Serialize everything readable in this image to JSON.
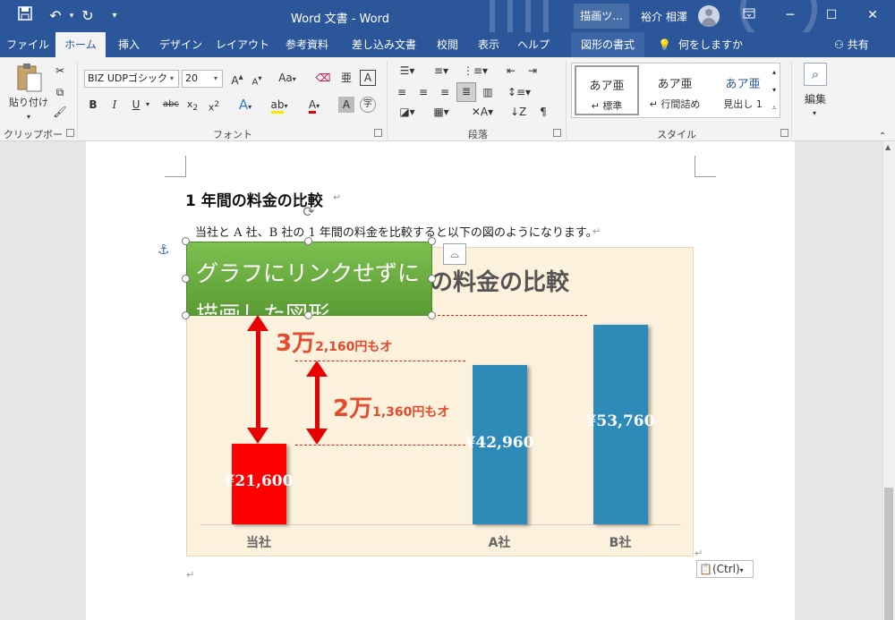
{
  "titlebar": {
    "doc_title": "Word 文書  -  Word",
    "drawing_tools": "描画ツ...",
    "user_name": "裕介 相澤",
    "icons": [
      "save-icon",
      "undo-icon",
      "redo-icon",
      "customize-qat-icon"
    ]
  },
  "tabs": [
    "ファイル",
    "ホーム",
    "挿入",
    "デザイン",
    "レイアウト",
    "参考資料",
    "差し込み文書",
    "校閲",
    "表示",
    "ヘルプ",
    "図形の書式"
  ],
  "active_tab": "ホーム",
  "tell_me": "何をしますか",
  "share": "共有",
  "ribbon": {
    "clipboard": {
      "paste": "貼り付け",
      "label": "クリップボード"
    },
    "font": {
      "name": "BIZ UDPゴシック",
      "size": "20",
      "label": "フォント",
      "case_btn": "Aa"
    },
    "paragraph": {
      "label": "段落"
    },
    "styles": {
      "label": "スタイル",
      "items": [
        {
          "sample": "あア亜",
          "name": "↵ 標準"
        },
        {
          "sample": "あア亜",
          "name": "↵ 行間詰め"
        },
        {
          "sample": "あア亜",
          "name": "見出し 1"
        }
      ]
    },
    "editing": {
      "label": "編集"
    }
  },
  "document": {
    "heading": "1 年間の料金の比較",
    "body": "当社と A 社、B 社の 1 年間の料金を比較すると以下の図のようになります。",
    "shape_text": "グラフにリンクせずに描画した図形",
    "paste_ctrl": "(Ctrl)"
  },
  "chart_data": {
    "type": "bar",
    "title": "の料金の比較",
    "categories": [
      "当社",
      "A社",
      "B社"
    ],
    "values": [
      21600,
      42960,
      53760
    ],
    "value_labels": [
      "¥21,600",
      "¥42,960",
      "¥53,760"
    ],
    "bar_colors": [
      "#ff0000",
      "#2e8bb8",
      "#2e8bb8"
    ],
    "annotations": [
      {
        "big": "3万",
        "small": "2,160円もオ"
      },
      {
        "big": "2万",
        "small": "1,360円もオ"
      }
    ]
  }
}
